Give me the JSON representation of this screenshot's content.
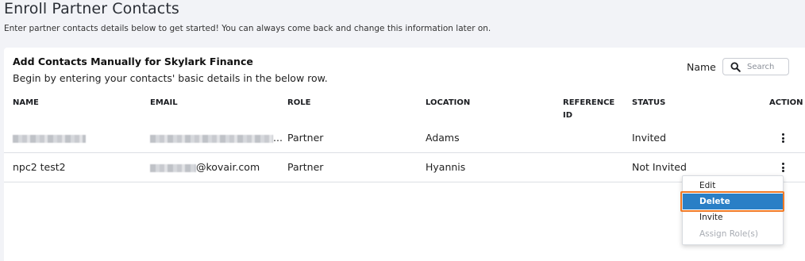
{
  "page": {
    "title": "Enroll Partner Contacts",
    "subtitle": "Enter partner contacts details below to get started! You can always come back and change this information later on."
  },
  "card": {
    "title": "Add Contacts Manually for Skylark Finance",
    "description": "Begin by entering your contacts' basic details in the below row.",
    "filter": {
      "label": "Name",
      "search_icon": "search-icon",
      "placeholder": "Search",
      "value": ""
    }
  },
  "table": {
    "columns": [
      {
        "key": "name",
        "label": "NAME"
      },
      {
        "key": "email",
        "label": "EMAIL"
      },
      {
        "key": "role",
        "label": "ROLE"
      },
      {
        "key": "location",
        "label": "LOCATION"
      },
      {
        "key": "reference_id",
        "label": "REFERENCE ID"
      },
      {
        "key": "status",
        "label": "STATUS"
      },
      {
        "key": "action",
        "label": "ACTION"
      }
    ],
    "rows": [
      {
        "name": "",
        "name_redacted": true,
        "email": "...",
        "email_redacted": true,
        "role": "Partner",
        "location": "Adams",
        "reference_id": "",
        "status": "Invited",
        "action_icon": "more-vertical-icon"
      },
      {
        "name": "npc2 test2",
        "email": "@kovair.com",
        "email_redacted": true,
        "role": "Partner",
        "location": "Hyannis",
        "reference_id": "",
        "status": "Not Invited",
        "action_icon": "more-vertical-icon"
      }
    ]
  },
  "action_menu": {
    "items": [
      {
        "label": "Edit",
        "state": "normal"
      },
      {
        "label": "Delete",
        "state": "selected"
      },
      {
        "label": "Invite",
        "state": "normal"
      },
      {
        "label": "Assign Role(s)",
        "state": "disabled"
      }
    ]
  },
  "colors": {
    "page_background": "#f2f3f7",
    "card_background": "#ffffff",
    "selected_menu_item": "#2a7fc6",
    "focus_outline": "#f07a26",
    "row_divider": "#dcdfe4"
  }
}
